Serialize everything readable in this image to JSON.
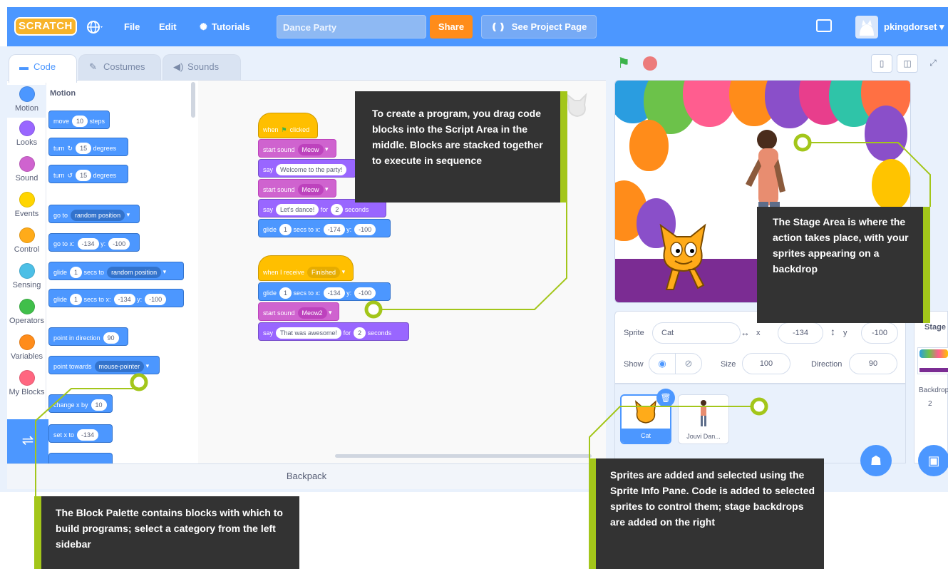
{
  "menubar": {
    "logo_text": "SCRATCH",
    "globe_icon": "globe-icon",
    "file_label": "File",
    "edit_label": "Edit",
    "tutorials_label": "Tutorials",
    "project_title": "Dance Party",
    "share_label": "Share",
    "see_project_label": "See Project Page",
    "username": "pkingdorset"
  },
  "tabs": [
    {
      "label": "Code",
      "icon": "code-icon"
    },
    {
      "label": "Costumes",
      "icon": "brush-icon"
    },
    {
      "label": "Sounds",
      "icon": "speaker-icon"
    }
  ],
  "categories": [
    {
      "label": "Motion",
      "color": "#4c97ff"
    },
    {
      "label": "Looks",
      "color": "#9966ff"
    },
    {
      "label": "Sound",
      "color": "#cf63cf"
    },
    {
      "label": "Events",
      "color": "#ffd500"
    },
    {
      "label": "Control",
      "color": "#ffab19"
    },
    {
      "label": "Sensing",
      "color": "#4cbfe6"
    },
    {
      "label": "Operators",
      "color": "#40bf4a"
    },
    {
      "label": "Variables",
      "color": "#ff8c1a"
    },
    {
      "label": "My Blocks",
      "color": "#ff6680"
    }
  ],
  "palette": {
    "heading": "Motion",
    "move": {
      "text": "move",
      "steps": "10",
      "unit": "steps"
    },
    "turn_right": {
      "text": "turn",
      "degrees": "15",
      "unit": "degrees"
    },
    "turn_left": {
      "text": "turn",
      "degrees": "15",
      "unit": "degrees"
    },
    "goto_random": {
      "text": "go to",
      "target": "random position"
    },
    "goto_xy": {
      "text": "go to x:",
      "x": "-134",
      "ylabel": "y:",
      "y": "-100"
    },
    "glide_random": {
      "text": "glide",
      "secs": "1",
      "mid": "secs to",
      "target": "random position"
    },
    "glide_xy": {
      "text": "glide",
      "secs": "1",
      "mid": "secs to x:",
      "x": "-134",
      "ylabel": "y:",
      "y": "-100"
    },
    "point_dir": {
      "text": "point in direction",
      "value": "90"
    },
    "point_towards": {
      "text": "point towards",
      "target": "mouse-pointer"
    },
    "change_x": {
      "text": "change x by",
      "value": "10"
    },
    "set_x": {
      "text": "set x to",
      "value": "-134"
    }
  },
  "script1": {
    "hat": "when",
    "hat_end": "clicked",
    "sound1": {
      "text": "start sound",
      "value": "Meow"
    },
    "say1": {
      "text": "say",
      "value": "Welcome to the party!"
    },
    "sound2": {
      "text": "start sound",
      "value": "Meow"
    },
    "say2": {
      "text": "say",
      "value": "Let's dance!",
      "for": "for",
      "secs": "2",
      "unit": "seconds"
    },
    "glide": {
      "text": "glide",
      "secs": "1",
      "mid": "secs to x:",
      "x": "-174",
      "ylabel": "y:",
      "y": "-100"
    }
  },
  "script2": {
    "hat": "when I receive",
    "message": "Finished",
    "glide": {
      "text": "glide",
      "secs": "1",
      "mid": "secs to x:",
      "x": "-134",
      "ylabel": "y:",
      "y": "-100"
    },
    "sound": {
      "text": "start sound",
      "value": "Meow2"
    },
    "say": {
      "text": "say",
      "value": "That was awesome!",
      "for": "for",
      "secs": "2",
      "unit": "seconds"
    }
  },
  "backpack_label": "Backpack",
  "sprite_info": {
    "sprite_label": "Sprite",
    "sprite_name": "Cat",
    "x_label": "x",
    "x_value": "-134",
    "y_label": "y",
    "y_value": "-100",
    "show_label": "Show",
    "size_label": "Size",
    "size_value": "100",
    "direction_label": "Direction",
    "direction_value": "90"
  },
  "sprites": [
    {
      "name": "Cat",
      "selected": true
    },
    {
      "name": "Jouvi Dan...",
      "selected": false
    }
  ],
  "stage_target": {
    "label": "Stage",
    "backdrops_label": "Backdrop",
    "backdrops_count": "2"
  },
  "callouts": {
    "script": "To create a program, you drag code blocks into the Script Area in the middle. Blocks are stacked together to execute in sequence",
    "stage": "The Stage Area is where the action takes place, with your sprites appearing on a backdrop",
    "palette": "The Block Palette contains blocks with which to build programs; select a category from the left sidebar",
    "sprites": "Sprites are added and selected using the Sprite Info Pane. Code is added to selected sprites to control them; stage backdrops are added on the right"
  },
  "colors": {
    "accent": "#4c97ff",
    "callout_bg": "#333333",
    "callout_accent": "#a3c61a",
    "share": "#ff8c1a"
  }
}
